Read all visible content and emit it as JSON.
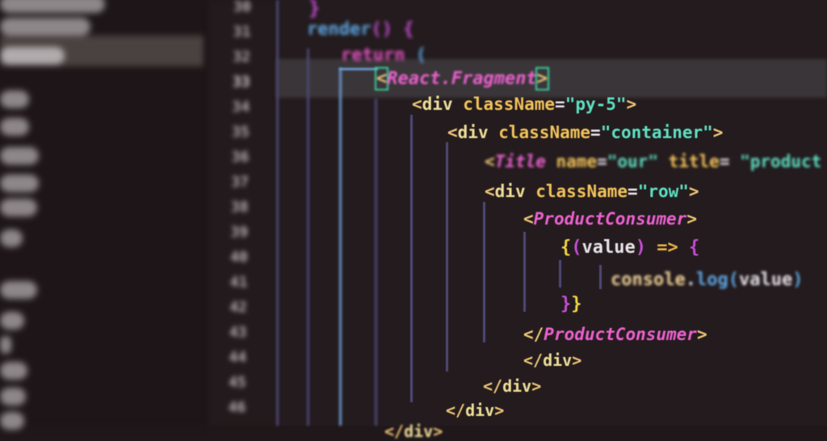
{
  "sidebar": {
    "items": [
      "",
      "",
      "",
      "",
      "",
      "",
      "",
      "",
      "",
      "",
      "",
      "",
      "",
      "",
      ""
    ],
    "active_index": 2
  },
  "gutter": {
    "line_numbers": [
      "30",
      "31",
      "32",
      "33",
      "34",
      "35",
      "36",
      "37",
      "38",
      "39",
      "40",
      "41",
      "42",
      "43",
      "44",
      "45",
      "46"
    ],
    "active_line": "33"
  },
  "editor": {
    "lines": [
      {
        "tokens": [
          {
            "t": "}",
            "c": "c-brace-m"
          }
        ]
      },
      {
        "tokens": [
          {
            "t": "render",
            "c": "c-fn"
          },
          {
            "t": "()",
            "c": "c-brace-m"
          },
          {
            "t": " {",
            "c": "c-brace-m"
          }
        ]
      },
      {
        "tokens": [
          {
            "t": "return",
            "c": "c-kw"
          },
          {
            "t": " (",
            "c": "c-fn"
          }
        ]
      },
      {
        "tokens": [
          {
            "t": "<",
            "c": "c-punc",
            "box": true
          },
          {
            "t": "React.Fragment",
            "c": "c-comp"
          },
          {
            "t": ">",
            "c": "c-punc",
            "box": true
          }
        ]
      },
      {
        "tokens": [
          {
            "t": "<",
            "c": "c-punc"
          },
          {
            "t": "div",
            "c": "c-tag"
          },
          {
            "t": " className",
            "c": "c-attr"
          },
          {
            "t": "=",
            "c": "c-var"
          },
          {
            "t": "\"py-5\"",
            "c": "c-str"
          },
          {
            "t": ">",
            "c": "c-punc"
          }
        ]
      },
      {
        "tokens": [
          {
            "t": "<",
            "c": "c-punc"
          },
          {
            "t": "div",
            "c": "c-tag"
          },
          {
            "t": " className",
            "c": "c-attr"
          },
          {
            "t": "=",
            "c": "c-var"
          },
          {
            "t": "\"container\"",
            "c": "c-str"
          },
          {
            "t": ">",
            "c": "c-punc"
          }
        ]
      },
      {
        "tokens": [
          {
            "t": "<",
            "c": "c-punc"
          },
          {
            "t": "Title",
            "c": "c-comp"
          },
          {
            "t": " name",
            "c": "c-attr"
          },
          {
            "t": "=",
            "c": "c-var"
          },
          {
            "t": "\"our\"",
            "c": "c-str"
          },
          {
            "t": " title",
            "c": "c-attr"
          },
          {
            "t": "= ",
            "c": "c-var"
          },
          {
            "t": "\"product",
            "c": "c-str"
          }
        ]
      },
      {
        "tokens": [
          {
            "t": "<",
            "c": "c-punc"
          },
          {
            "t": "div",
            "c": "c-tag"
          },
          {
            "t": " className",
            "c": "c-attr"
          },
          {
            "t": "=",
            "c": "c-var"
          },
          {
            "t": "\"row\"",
            "c": "c-str"
          },
          {
            "t": ">",
            "c": "c-punc"
          }
        ]
      },
      {
        "tokens": [
          {
            "t": "<",
            "c": "c-punc"
          },
          {
            "t": "ProductConsumer",
            "c": "c-comp"
          },
          {
            "t": ">",
            "c": "c-punc"
          }
        ]
      },
      {
        "tokens": [
          {
            "t": "{",
            "c": "c-brace-y"
          },
          {
            "t": "(",
            "c": "c-brace-m"
          },
          {
            "t": "value",
            "c": "c-var"
          },
          {
            "t": ")",
            "c": "c-brace-m"
          },
          {
            "t": " => ",
            "c": "c-arrow"
          },
          {
            "t": "{",
            "c": "c-brace-m"
          }
        ]
      },
      {
        "tokens": [
          {
            "t": "console",
            "c": "c-obj"
          },
          {
            "t": ".",
            "c": "c-var"
          },
          {
            "t": "log",
            "c": "c-fn"
          },
          {
            "t": "(",
            "c": "c-fn"
          },
          {
            "t": "value",
            "c": "c-var"
          },
          {
            "t": ")",
            "c": "c-fn"
          }
        ]
      },
      {
        "tokens": [
          {
            "t": "}",
            "c": "c-brace-m"
          },
          {
            "t": "}",
            "c": "c-brace-y"
          }
        ]
      },
      {
        "tokens": [
          {
            "t": "</",
            "c": "c-punc"
          },
          {
            "t": "ProductConsumer",
            "c": "c-comp"
          },
          {
            "t": ">",
            "c": "c-punc"
          }
        ]
      },
      {
        "tokens": [
          {
            "t": "</",
            "c": "c-punc"
          },
          {
            "t": "div",
            "c": "c-tag"
          },
          {
            "t": ">",
            "c": "c-punc"
          }
        ]
      },
      {
        "tokens": [
          {
            "t": "</",
            "c": "c-punc"
          },
          {
            "t": "div",
            "c": "c-tag"
          },
          {
            "t": ">",
            "c": "c-punc"
          }
        ]
      },
      {
        "tokens": [
          {
            "t": "</",
            "c": "c-punc"
          },
          {
            "t": "div",
            "c": "c-tag"
          },
          {
            "t": ">",
            "c": "c-punc"
          }
        ]
      },
      {
        "tokens": [
          {
            "t": "</",
            "c": "c-punc"
          },
          {
            "t": "div",
            "c": "c-tag"
          },
          {
            "t": ">",
            "c": "c-punc"
          }
        ]
      }
    ],
    "current_line_index": 3
  }
}
